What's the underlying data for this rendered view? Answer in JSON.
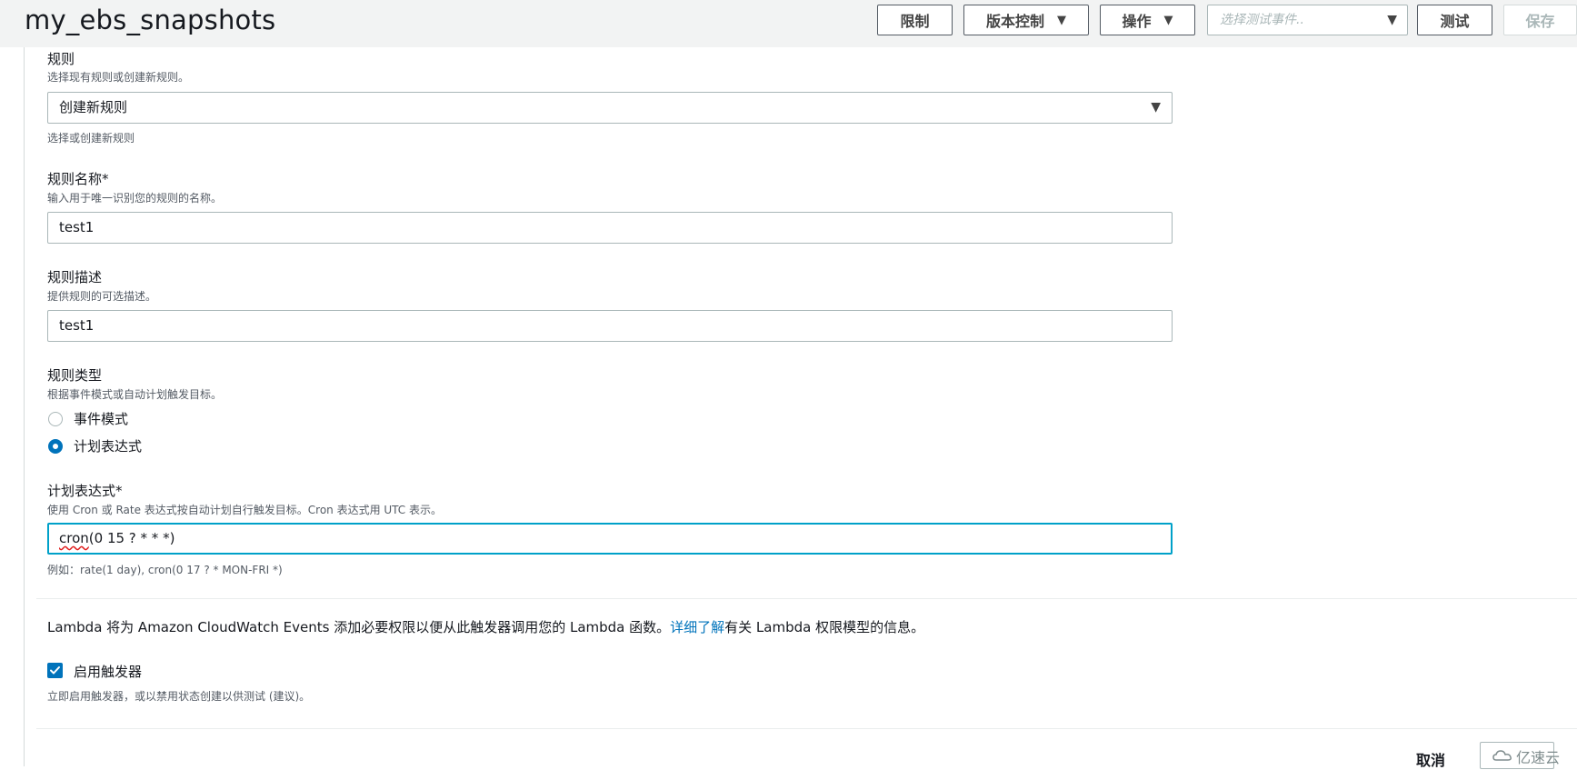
{
  "header": {
    "function_name": "my_ebs_snapshots",
    "throttle_label": "限制",
    "versions_label": "版本控制",
    "actions_label": "操作",
    "test_event_placeholder": "选择测试事件..",
    "test_label": "测试",
    "save_label": "保存"
  },
  "rule": {
    "label": "规则",
    "desc": "选择现有规则或创建新规则。",
    "selected": "创建新规则",
    "hint": "选择或创建新规则"
  },
  "rule_name": {
    "label": "规则名称*",
    "desc": "输入用于唯一识别您的规则的名称。",
    "value": "test1"
  },
  "rule_description": {
    "label": "规则描述",
    "desc": "提供规则的可选描述。",
    "value": "test1"
  },
  "rule_type": {
    "label": "规则类型",
    "desc": "根据事件模式或自动计划触发目标。",
    "options": [
      "事件模式",
      "计划表达式"
    ],
    "selected_index": 1
  },
  "schedule_expression": {
    "label": "计划表达式*",
    "desc": "使用 Cron 或 Rate 表达式按自动计划自行触发目标。Cron 表达式用 UTC 表示。",
    "value_fn": "cron",
    "value_rest": "(0 15 ? * * *)",
    "example": "例如：rate(1 day), cron(0 17 ? * MON-FRI *)"
  },
  "permissions_note": {
    "before": "Lambda 将为 Amazon CloudWatch Events 添加必要权限以便从此触发器调用您的 Lambda 函数。",
    "link": "详细了解",
    "after": "有关 Lambda 权限模型的信息。"
  },
  "enable_trigger": {
    "label": "启用触发器",
    "checked": true,
    "desc": "立即启用触发器，或以禁用状态创建以供测试 (建议)。"
  },
  "footer": {
    "cancel_label": "取消"
  },
  "watermark": {
    "text": "亿速云"
  }
}
